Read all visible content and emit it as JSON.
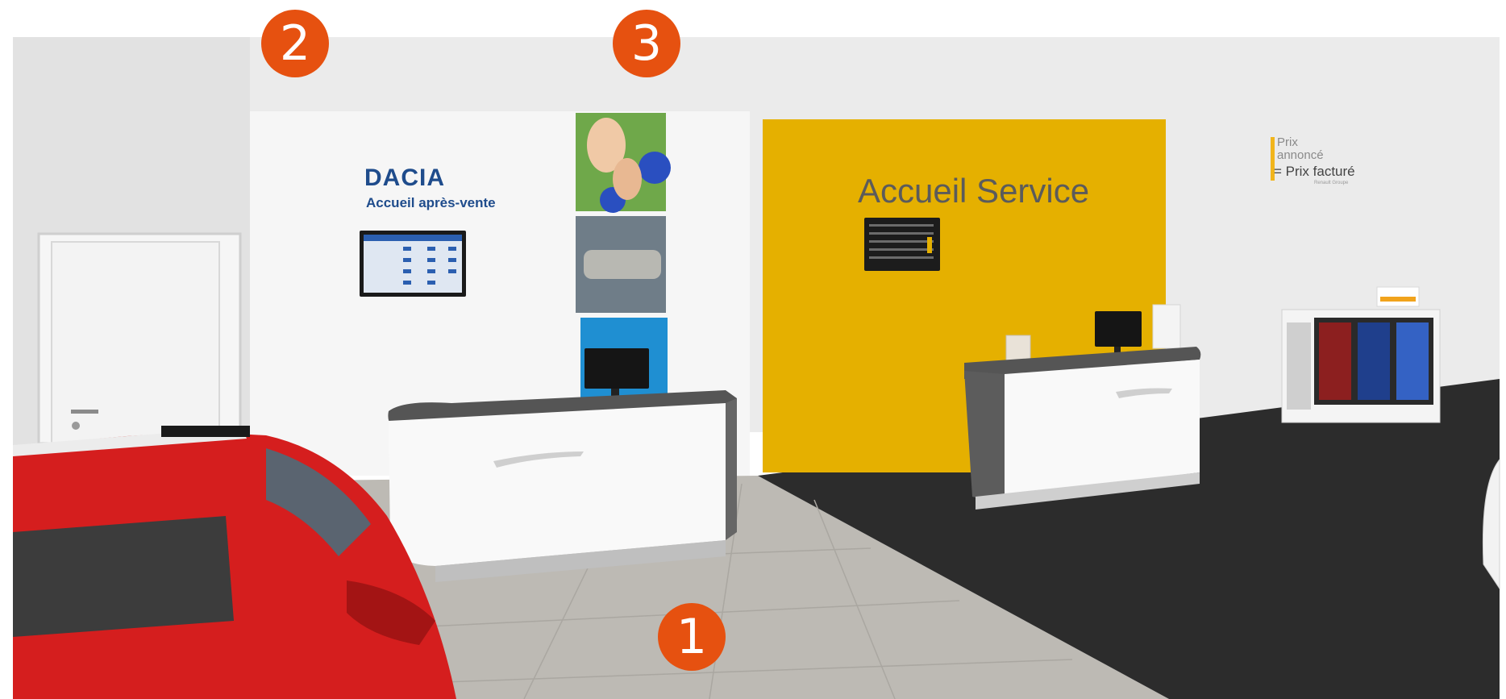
{
  "badges": [
    {
      "number": "1"
    },
    {
      "number": "2"
    },
    {
      "number": "3"
    }
  ],
  "left_wall": {
    "brand": "DACIA",
    "subtitle": "Accueil après-vente"
  },
  "service_wall": {
    "title": "Accueil Service"
  },
  "price_sign": {
    "line1": "Prix",
    "line2": "annoncé",
    "line3": "= Prix facturé",
    "line4": "Renault Groupe"
  },
  "colors": {
    "badge": "#e65110",
    "service_wall": "#e5b000",
    "brand_text": "#1f4c8c",
    "car_red": "#d51e1e",
    "floor_dark": "#2c2c2c",
    "floor_tile": "#bdbab4"
  }
}
